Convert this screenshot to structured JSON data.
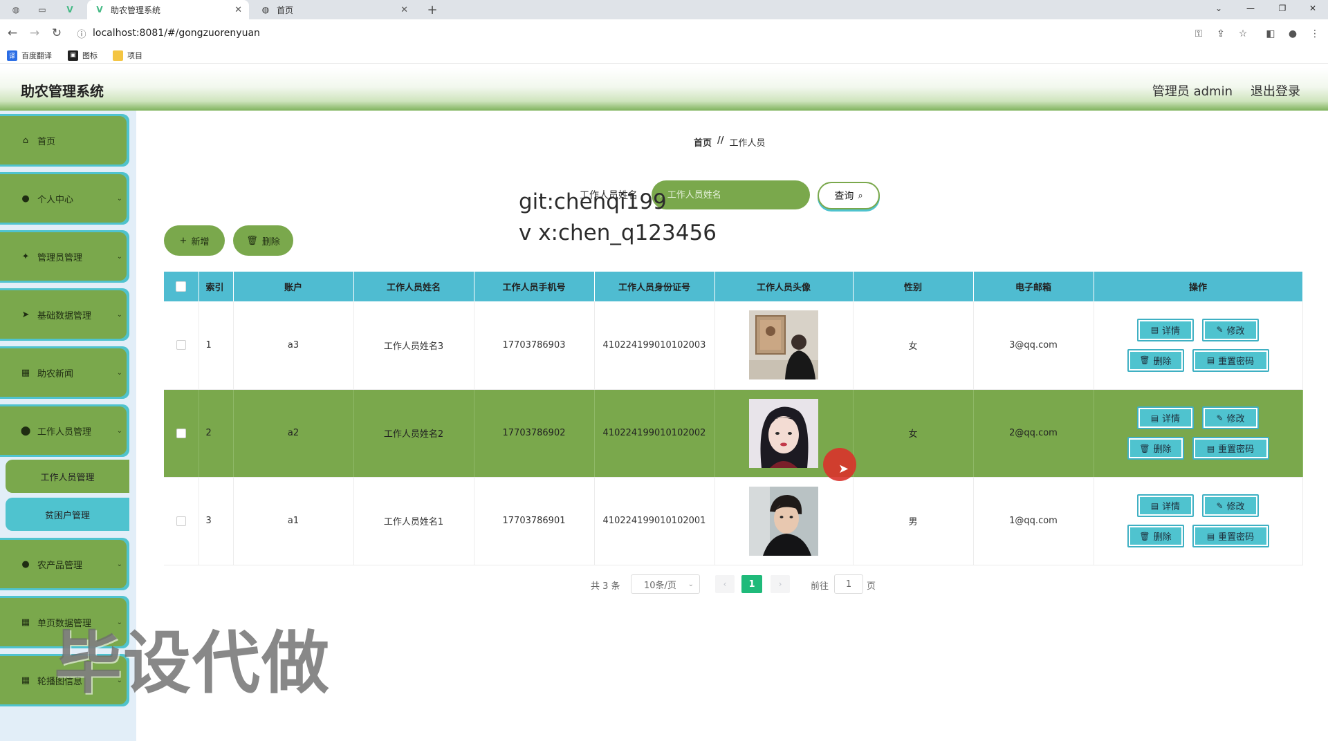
{
  "browser": {
    "tabs": [
      {
        "title": "助农管理系统",
        "icon": "vue-logo-icon",
        "active": true
      },
      {
        "title": "首页",
        "icon": "globe-icon",
        "active": false
      }
    ],
    "close_glyph": "✕",
    "new_tab_glyph": "+",
    "url": "localhost:8081/#/gongzuorenyuan",
    "bookmarks": [
      {
        "label": "百度翻译",
        "icon": "translate-icon"
      },
      {
        "label": "图标",
        "icon": "image-icon"
      },
      {
        "label": "项目",
        "icon": "folder-icon"
      }
    ]
  },
  "header": {
    "title": "助农管理系统",
    "admin_label": "管理员 admin",
    "logout_label": "退出登录"
  },
  "sidebar": {
    "items": [
      {
        "label": "首页",
        "icon": "home-icon",
        "has_caret": false
      },
      {
        "label": "个人中心",
        "icon": "user-icon",
        "has_caret": true
      },
      {
        "label": "管理员管理",
        "icon": "admin-icon",
        "has_caret": true
      },
      {
        "label": "基础数据管理",
        "icon": "send-icon",
        "has_caret": true
      },
      {
        "label": "助农新闻",
        "icon": "grid-icon",
        "has_caret": true
      },
      {
        "label": "工作人员管理",
        "icon": "location-icon",
        "has_caret": true
      },
      {
        "label": "农产品管理",
        "icon": "user-icon",
        "has_caret": true
      },
      {
        "label": "单页数据管理",
        "icon": "grid-icon",
        "has_caret": true
      },
      {
        "label": "轮播图信息",
        "icon": "grid-icon",
        "has_caret": true
      }
    ],
    "sub_items": [
      {
        "label": "工作人员管理",
        "active": true
      },
      {
        "label": "贫困户管理",
        "active": false
      }
    ]
  },
  "breadcrumb": {
    "home": "首页",
    "separator": "//",
    "current": "工作人员"
  },
  "search": {
    "label": "工作人员姓名",
    "placeholder": "工作人员姓名",
    "value": "",
    "query_label": "查询"
  },
  "actions": {
    "add_label": "新增",
    "delete_label": "删除"
  },
  "overlay": {
    "line1": "git:chenqi199",
    "line2": "v x:chen_q123456",
    "big_watermark": "毕设代做"
  },
  "table": {
    "columns": [
      "索引",
      "账户",
      "工作人员姓名",
      "工作人员手机号",
      "工作人员身份证号",
      "工作人员头像",
      "性别",
      "电子邮箱",
      "操作"
    ],
    "rows": [
      {
        "index": "1",
        "account": "a3",
        "name": "工作人员姓名3",
        "phone": "17703786903",
        "id_card": "410224199010102003",
        "avatar": "avatar-photo-1",
        "gender": "女",
        "email": "3@qq.com",
        "highlighted": false
      },
      {
        "index": "2",
        "account": "a2",
        "name": "工作人员姓名2",
        "phone": "17703786902",
        "id_card": "410224199010102002",
        "avatar": "avatar-photo-2",
        "gender": "女",
        "email": "2@qq.com",
        "highlighted": true
      },
      {
        "index": "3",
        "account": "a1",
        "name": "工作人员姓名1",
        "phone": "17703786901",
        "id_card": "410224199010102001",
        "avatar": "avatar-photo-3",
        "gender": "男",
        "email": "1@qq.com",
        "highlighted": false
      }
    ],
    "row_actions": {
      "detail": "详情",
      "edit": "修改",
      "delete": "删除",
      "reset_password": "重置密码"
    }
  },
  "pagination": {
    "total_text": "共 3 条",
    "page_size": "10条/页",
    "current_page": "1",
    "goto_label": "前往",
    "goto_value": "1",
    "page_suffix": "页"
  },
  "colors": {
    "primary_green": "#7aa84c",
    "accent_cyan": "#4fc3cf",
    "pagination_active": "#1fba7a",
    "sidebar_bg": "#e2eef8"
  }
}
